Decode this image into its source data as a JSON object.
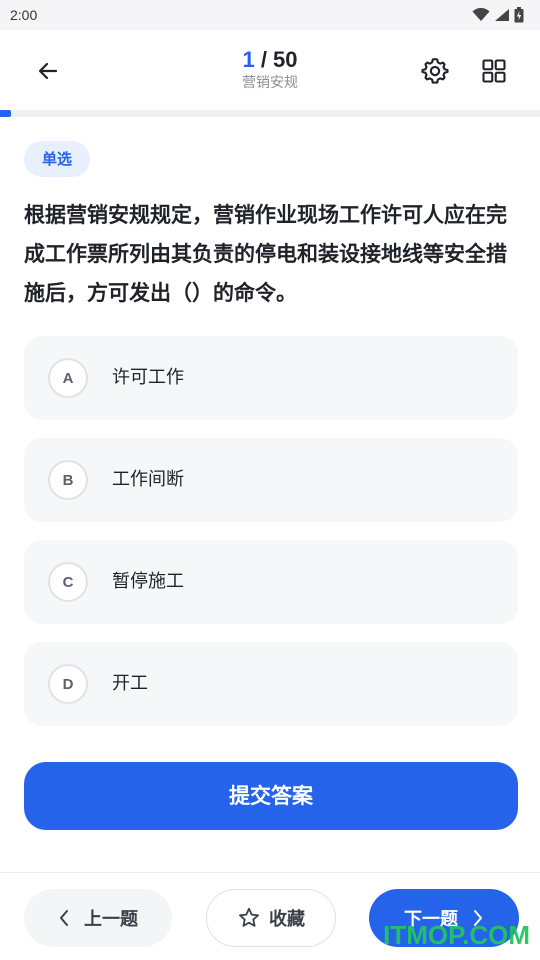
{
  "status_bar": {
    "time": "2:00",
    "icons": [
      "wifi-icon",
      "signal-icon",
      "battery-icon"
    ]
  },
  "header": {
    "current": "1",
    "separator": " / ",
    "total": "50",
    "subtitle": "营销安规",
    "back_icon": "arrow-left-icon",
    "settings_icon": "gear-icon",
    "grid_icon": "grid-icon"
  },
  "progress": {
    "fraction": 0.02
  },
  "question": {
    "type_label": "单选",
    "text": "根据营销安规规定，营销作业现场工作许可人应在完成工作票所列由其负责的停电和装设接地线等安全措施后，方可发出（）的命令。"
  },
  "options": [
    {
      "letter": "A",
      "text": "许可工作"
    },
    {
      "letter": "B",
      "text": "工作间断"
    },
    {
      "letter": "C",
      "text": "暂停施工"
    },
    {
      "letter": "D",
      "text": "开工"
    }
  ],
  "actions": {
    "submit_label": "提交答案",
    "prev_label": "上一题",
    "favorite_label": "收藏",
    "next_label": "下一题"
  },
  "watermark": "ITMOP.COM",
  "colors": {
    "accent": "#2563eb",
    "badge_bg": "#e8f0fe",
    "option_bg": "#f6f7f9",
    "watermark": "#22c55e"
  }
}
